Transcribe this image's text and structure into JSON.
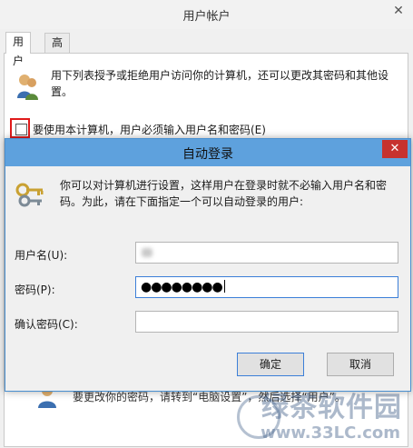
{
  "background_window": {
    "title": "用户帐户",
    "close_glyph": "✕",
    "tabs": [
      {
        "label": "用户",
        "active": true
      },
      {
        "label": "高级",
        "active": false
      }
    ],
    "intro_text": "用下列表授予或拒绝用户访问你的计算机，还可以更改其密码和其他设置。",
    "require_checkbox_label": "要使用本计算机，用户必须输入用户名和密码(E)",
    "require_checkbox_checked": false,
    "bottom_text_partial": "要更改你的密码，请转到“电脑设置”，然后选择“用户”。",
    "highlight_color": "#e01a1a"
  },
  "dialog": {
    "title": "自动登录",
    "close_glyph": "✕",
    "description": "你可以对计算机进行设置，这样用户在登录时就不必输入用户名和密码。为此，请在下面指定一个可以自动登录的用户:",
    "fields": [
      {
        "label": "用户名(U):",
        "value": ""
      },
      {
        "label": "密码(P):",
        "value": "●●●●●●●●"
      },
      {
        "label": "确认密码(C):",
        "value": ""
      }
    ],
    "ok_label": "确定",
    "cancel_label": "取消",
    "title_bar_color": "#5ea1dd",
    "close_color": "#c7322f"
  },
  "watermark": {
    "brand": "绿茶软件园",
    "url": "www.33LC.com"
  }
}
